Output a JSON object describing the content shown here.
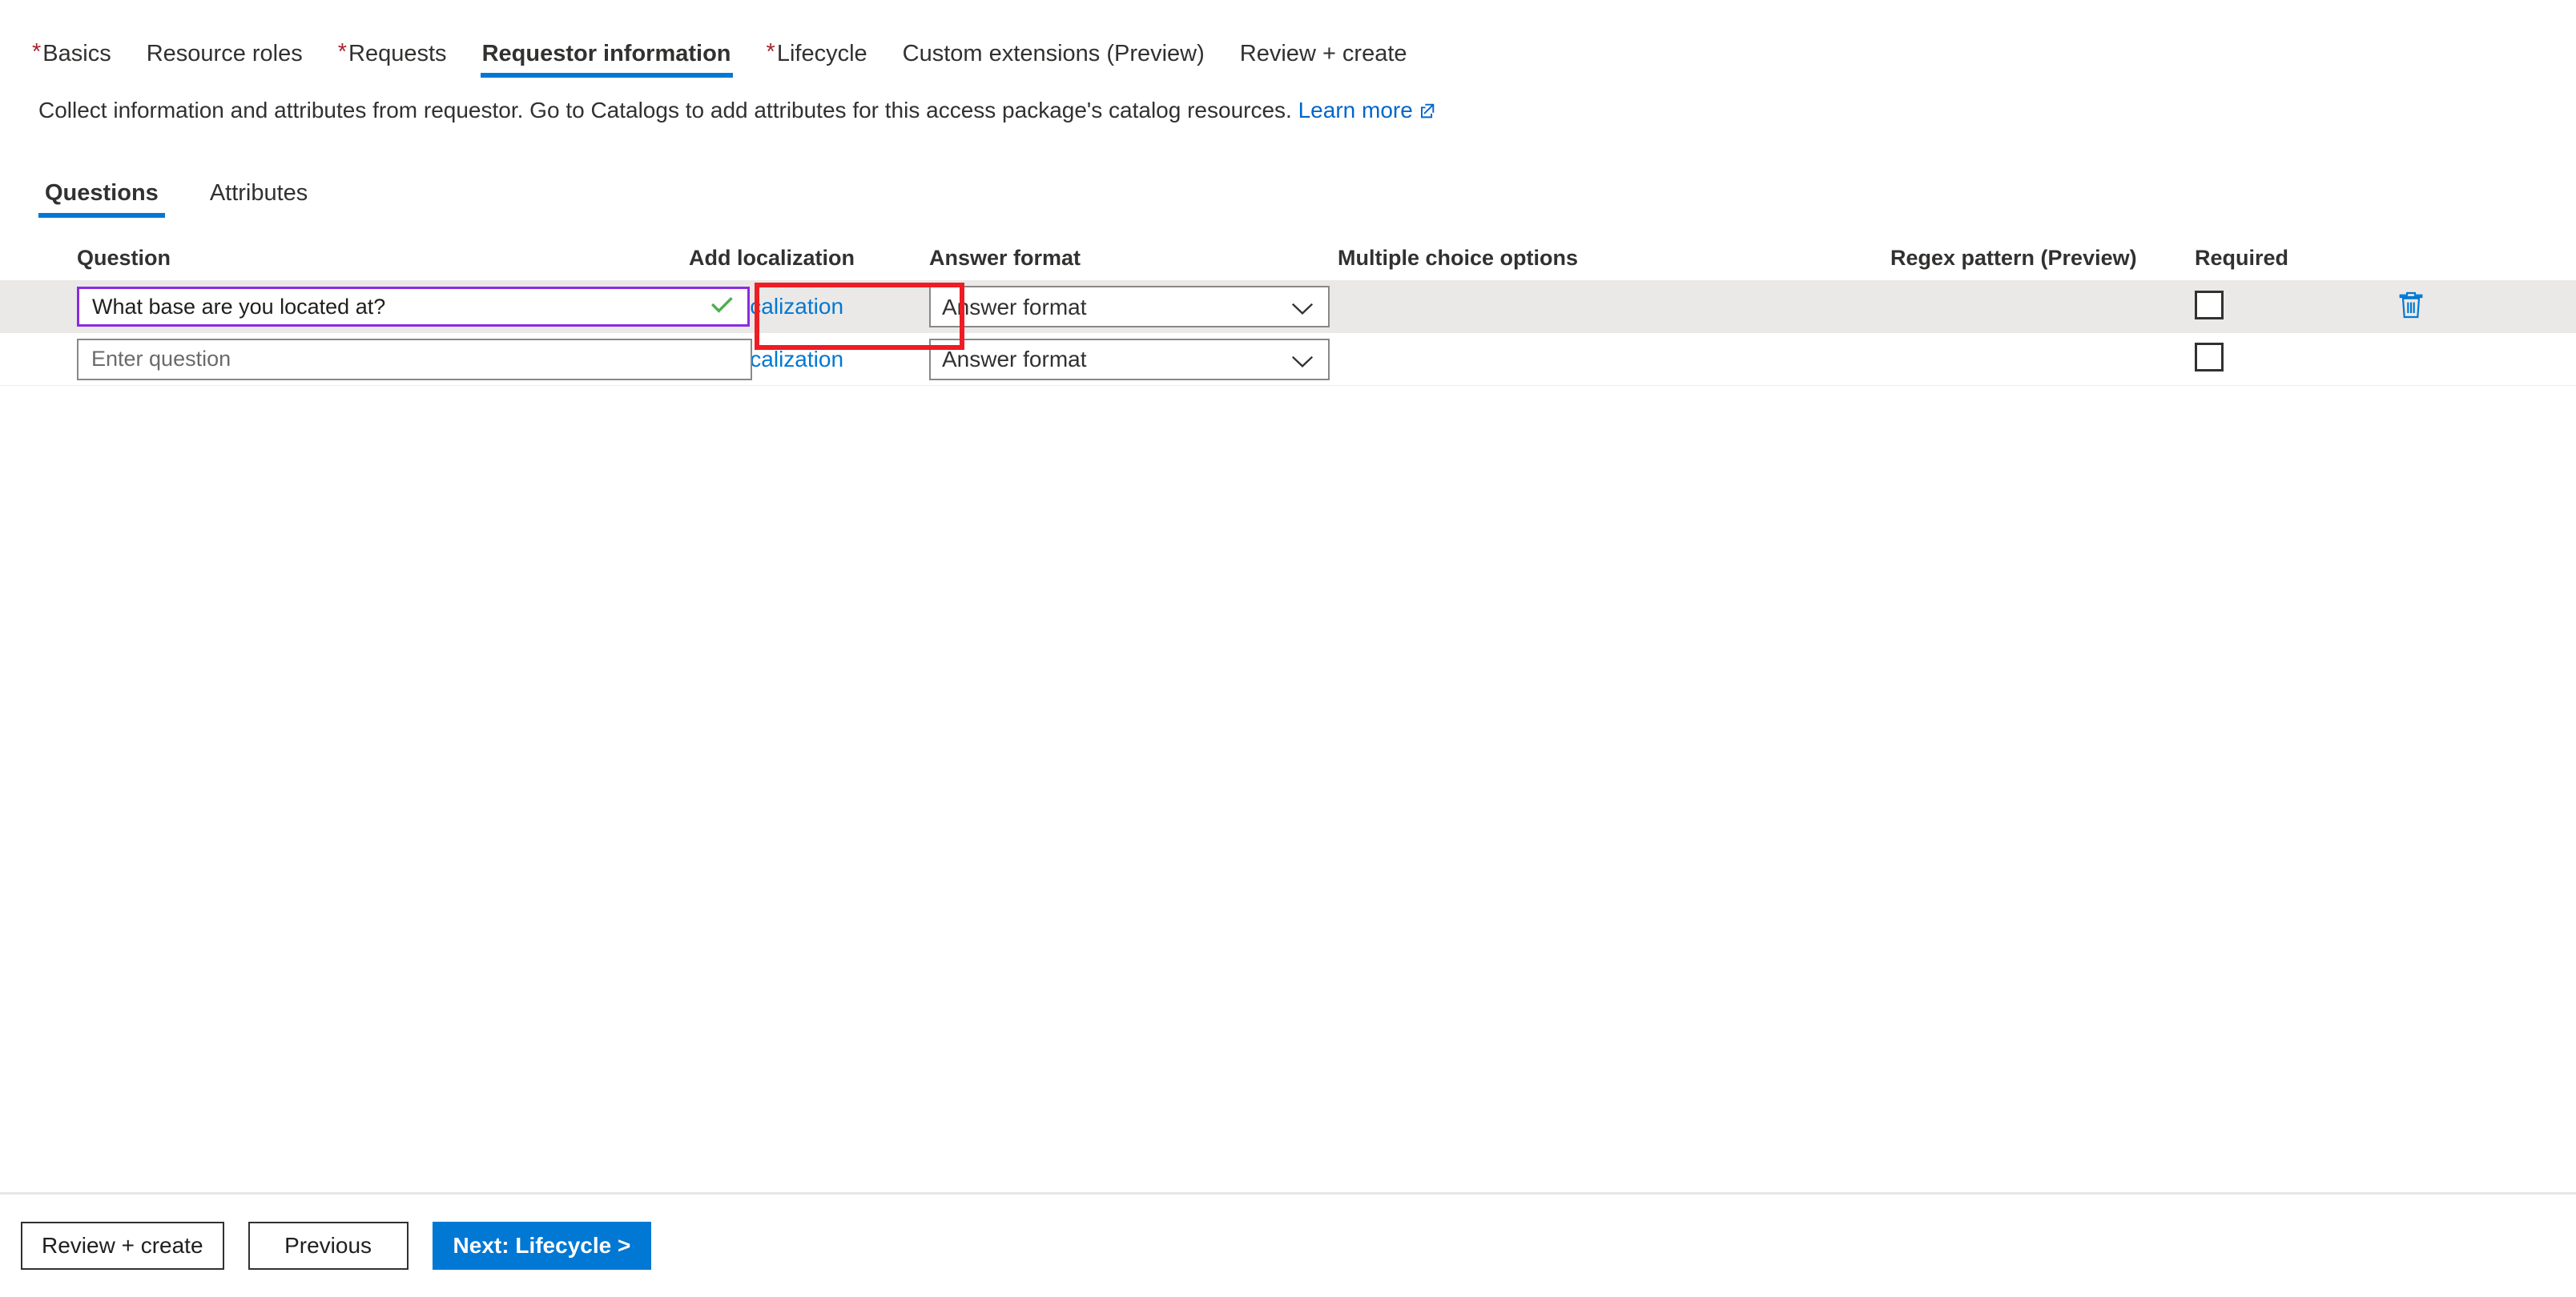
{
  "wizard": {
    "tabs": [
      {
        "label": "Basics",
        "required": true,
        "selected": false
      },
      {
        "label": "Resource roles",
        "required": false,
        "selected": false
      },
      {
        "label": "Requests",
        "required": true,
        "selected": false
      },
      {
        "label": "Requestor information",
        "required": false,
        "selected": true
      },
      {
        "label": "Lifecycle",
        "required": true,
        "selected": false
      },
      {
        "label": "Custom extensions (Preview)",
        "required": false,
        "selected": false
      },
      {
        "label": "Review + create",
        "required": false,
        "selected": false
      }
    ]
  },
  "description": {
    "text": "Collect information and attributes from requestor. Go to Catalogs to add attributes for this access package's catalog resources.",
    "link_label": "Learn more",
    "link_icon": "external-link-icon"
  },
  "sub_tabs": [
    {
      "label": "Questions",
      "selected": true
    },
    {
      "label": "Attributes",
      "selected": false
    }
  ],
  "table": {
    "headers": {
      "question": "Question",
      "localization": "Add localization",
      "answer_format": "Answer format",
      "multiple_choice": "Multiple choice options",
      "regex": "Regex pattern (Preview)",
      "required": "Required"
    },
    "rows": [
      {
        "question_value": "What base are you located at?",
        "question_placeholder": "",
        "question_valid": true,
        "localization_label": "add localization",
        "answer_format_value": "Answer format",
        "answer_format_options": [
          "Answer format"
        ],
        "multiple_choice": "",
        "regex": "",
        "required_checked": false,
        "has_delete": true,
        "shaded": true,
        "highlighted_cell": "localization"
      },
      {
        "question_value": "",
        "question_placeholder": "Enter question",
        "question_valid": false,
        "localization_label": "add localization",
        "answer_format_value": "Answer format",
        "answer_format_options": [
          "Answer format"
        ],
        "multiple_choice": "",
        "regex": "",
        "required_checked": false,
        "has_delete": false,
        "shaded": false,
        "highlighted_cell": ""
      }
    ]
  },
  "footer": {
    "review_label": "Review + create",
    "previous_label": "Previous",
    "next_label": "Next: Lifecycle >"
  },
  "colors": {
    "accent": "#0078d4",
    "highlight": "#ee1c25",
    "required_star": "#a4262c",
    "valid_check": "#4caf50",
    "focus_border": "#8a2be2",
    "row_shade": "#ebe9e7"
  }
}
